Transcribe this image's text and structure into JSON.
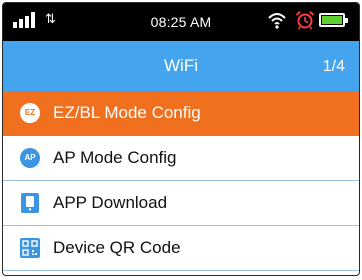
{
  "status_bar": {
    "time": "08:25 AM",
    "data_arrows": "⇅"
  },
  "header": {
    "title": "WiFi",
    "page_indicator": "1/4"
  },
  "menu": {
    "items": [
      {
        "label": "EZ/BL Mode Config",
        "icon_text": "EZ",
        "icon": "ez-mode-icon",
        "selected": true
      },
      {
        "label": "AP Mode Config",
        "icon_text": "AP",
        "icon": "ap-mode-icon",
        "selected": false
      },
      {
        "label": "APP Download",
        "icon": "phone-download-icon",
        "selected": false
      },
      {
        "label": "Device QR Code",
        "icon": "qr-code-icon",
        "selected": false
      }
    ]
  },
  "colors": {
    "header_blue": "#44a4ee",
    "selected_orange": "#f07020",
    "icon_blue": "#3d94e0",
    "battery_green": "#5fd12e"
  }
}
